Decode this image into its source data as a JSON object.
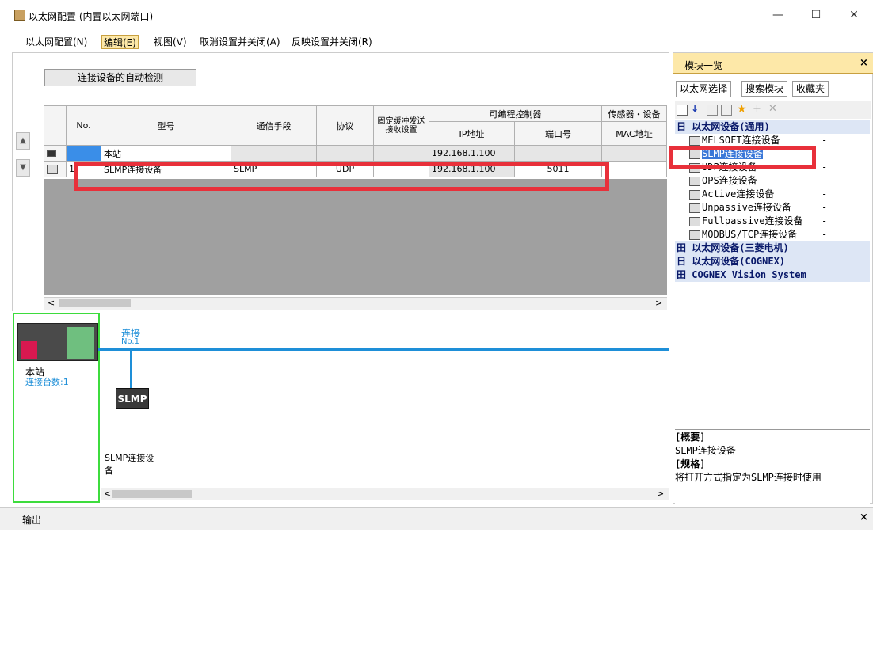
{
  "window": {
    "title": "以太网配置 (内置以太网端口)",
    "minimize": "—",
    "maximize": "☐",
    "close": "✕"
  },
  "menu": [
    "以太网配置(N)",
    "编辑(E)",
    "视图(V)",
    "取消设置并关闭(A)",
    "反映设置并关闭(R)"
  ],
  "autodetect_label": "连接设备的自动检测",
  "table": {
    "group_headers": {
      "plc": "可编程控制器",
      "sensor": "传感器・设备"
    },
    "headers": {
      "no": "No.",
      "model": "型号",
      "comm": "通信手段",
      "protocol": "协议",
      "fixed": "固定缓冲发送接收设置",
      "ip": "IP地址",
      "port": "端口号",
      "mac": "MAC地址"
    },
    "rows": [
      {
        "no": "",
        "model": "本站",
        "comm": "",
        "protocol": "",
        "fixed": "",
        "ip": "192.168.1.100",
        "port": "",
        "mac": ""
      },
      {
        "no": "1",
        "model": "SLMP连接设备",
        "comm": "SLMP",
        "protocol": "UDP",
        "fixed": "",
        "ip": "192.168.1.100",
        "port": "5011",
        "mac": ""
      }
    ]
  },
  "diagram": {
    "station_label": "本站",
    "station_count": "连接台数:1",
    "conn_label": "连接",
    "conn_no": "No.1",
    "node_label": "SLMP",
    "node_name": "SLMP连接设备"
  },
  "right_pane": {
    "title": "模块一览",
    "tabs": [
      "以太网选择",
      "搜索模块",
      "收藏夹"
    ],
    "tree": [
      {
        "type": "cat",
        "label": "日 以太网设备(通用)"
      },
      {
        "type": "item",
        "label": "MELSOFT连接设备",
        "value": "-"
      },
      {
        "type": "item",
        "label": "SLMP连接设备",
        "value": "-",
        "selected": true
      },
      {
        "type": "item",
        "label": "UDP连接设备",
        "value": "-"
      },
      {
        "type": "item",
        "label": "OPS连接设备",
        "value": "-"
      },
      {
        "type": "item",
        "label": "Active连接设备",
        "value": "-"
      },
      {
        "type": "item",
        "label": "Unpassive连接设备",
        "value": "-"
      },
      {
        "type": "item",
        "label": "Fullpassive连接设备",
        "value": "-"
      },
      {
        "type": "item",
        "label": "MODBUS/TCP连接设备",
        "value": "-"
      },
      {
        "type": "cat",
        "label": "田 以太网设备(三菱电机)"
      },
      {
        "type": "cat",
        "label": "日 以太网设备(COGNEX)"
      },
      {
        "type": "cat",
        "label": "田 COGNEX Vision System"
      }
    ],
    "desc": {
      "overview_h": "[概要]",
      "overview": "SLMP连接设备",
      "spec_h": "[规格]",
      "spec": "将打开方式指定为SLMP连接时使用"
    }
  },
  "output": {
    "title": "输出",
    "close": "×"
  },
  "colors": {
    "highlight": "#e8303a",
    "bus": "#1e8fd8",
    "green": "#3ddc3d"
  }
}
